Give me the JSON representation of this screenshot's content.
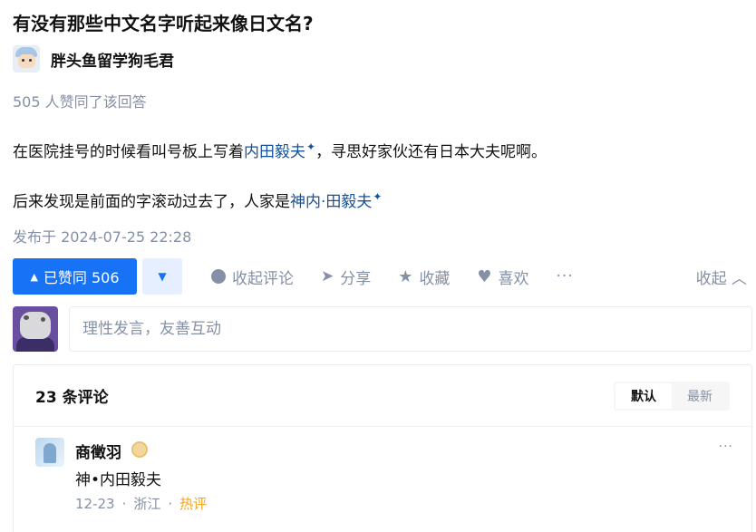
{
  "question": {
    "title": "有没有那些中文名字听起来像日文名?"
  },
  "author": {
    "name": "胖头鱼留学狗毛君",
    "avatar_icon": "cartoon-avatar"
  },
  "answer": {
    "votes_text": "505 人赞同了该回答",
    "para1": {
      "before": "在医院挂号的时候看叫号板上写着",
      "keyword": "内田毅夫",
      "after": "，寻思好家伙还有日本大夫呢啊。"
    },
    "para2": {
      "before": "后来发现是前面的字滚动过去了，人家是",
      "keyword": "神内·田毅夫"
    },
    "spark_glyph": "✦",
    "published": "发布于 2024-07-25 22:28"
  },
  "actions": {
    "vote_label": "已赞同 506",
    "comment_label": "收起评论",
    "share_label": "分享",
    "favorite_label": "收藏",
    "like_label": "喜欢",
    "more_label": "···",
    "collapse_label": "收起 ︿"
  },
  "reply": {
    "placeholder": "理性发言，友善互动"
  },
  "comments": {
    "count_label": "23 条评论",
    "sort": {
      "default_label": "默认",
      "latest_label": "最新",
      "active": "默认"
    },
    "items": [
      {
        "name": "商徵羽",
        "text": "神•内田毅夫",
        "date": "12-23",
        "location": "浙江",
        "dot": "·",
        "tag": "热评",
        "more": "···"
      }
    ]
  },
  "colors": {
    "brand": "#1772f6",
    "link": "#175199",
    "meta": "#8590a6",
    "hot": "#f1a41f"
  }
}
